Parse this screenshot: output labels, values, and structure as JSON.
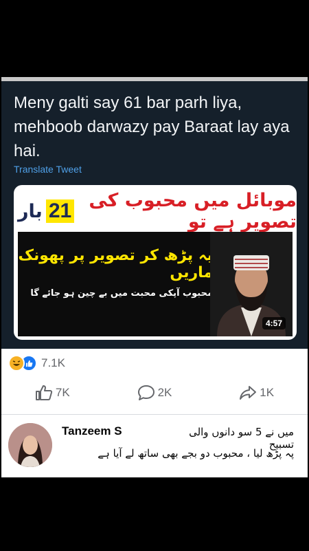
{
  "post": {
    "tweet_text": "Meny galti say 61 bar parh liya, mehboob darwazy pay Baraat lay aya hai.",
    "translate_label": "Translate Tweet"
  },
  "video": {
    "headline_part1": "موبائل میں محبوب کی تصویر ہے تو",
    "headline_number": "21",
    "headline_part2": "بار",
    "line_yellow": "یہ پڑھ کر تصویر پر پھونک ماریں",
    "line_white": "محبوب آپکی محبت میں بے چین ہو جائے گا",
    "duration": "4:57"
  },
  "engagement": {
    "reaction_count": "7.1K",
    "like_count": "7K",
    "comment_count": "2K",
    "share_count": "1K"
  },
  "comment": {
    "author": "Tanzeem S",
    "line1": "میں نے 5 سو دانوں والی تسبیح",
    "line2": "پہ پڑھ لیا ، محبوب دو بجے بھی ساتھ لے آیا ہے"
  },
  "colors": {
    "card_bg": "#15202b",
    "link_blue": "#4fa0e8",
    "highlight_yellow": "#ffe600",
    "headline_red": "#d81f26",
    "facebook_blue": "#1877f2"
  }
}
